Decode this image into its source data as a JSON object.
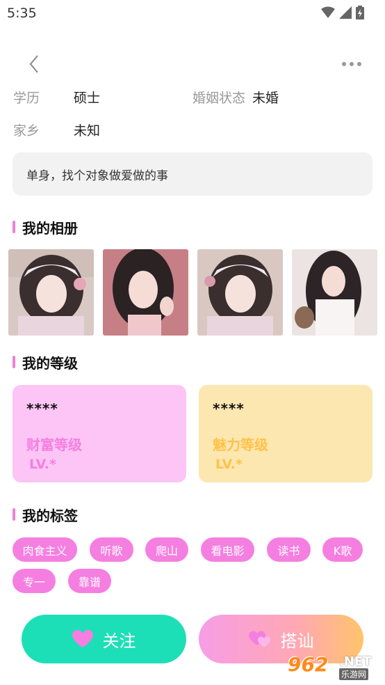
{
  "status_bar": {
    "time": "5:35"
  },
  "profile": {
    "education_label": "学历",
    "education_value": "硕士",
    "marital_label": "婚姻状态",
    "marital_value": "未婚",
    "hometown_label": "家乡",
    "hometown_value": "未知",
    "bio": "单身，找个对象做爱做的事"
  },
  "sections": {
    "album_title": "我的相册",
    "level_title": "我的等级",
    "tags_title": "我的标签"
  },
  "levels": {
    "wealth": {
      "stars": "****",
      "name": "财富等级",
      "lv": "LV.*",
      "color": "#f57fe0",
      "bg": "#fdc5f5"
    },
    "charm": {
      "stars": "****",
      "name": "魅力等级",
      "lv": "LV.*",
      "color": "#ffc24a",
      "bg": "#fde7b1"
    }
  },
  "tags": [
    "肉食主义",
    "听歌",
    "爬山",
    "看电影",
    "读书",
    "K歌",
    "专一",
    "靠谱"
  ],
  "buttons": {
    "follow": "关注",
    "chat": "搭讪"
  },
  "watermark": {
    "brand": "962",
    "domain": ".NET",
    "site": "乐游网"
  },
  "colors": {
    "accent_pink": "#f57fe0",
    "accent_green": "#1ddfb7"
  }
}
